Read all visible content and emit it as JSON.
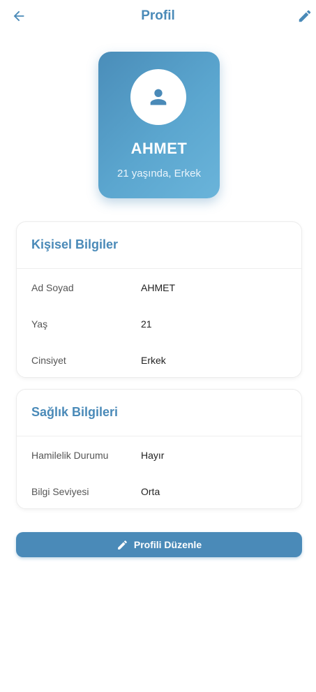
{
  "header": {
    "title": "Profil",
    "back_icon": "arrow-left-icon",
    "edit_icon": "pencil-icon"
  },
  "profile": {
    "avatar_icon": "person-icon",
    "name": "AHMET",
    "subtitle": "21 yaşında, Erkek"
  },
  "personal_info": {
    "title": "Kişisel Bilgiler",
    "rows": [
      {
        "label": "Ad Soyad",
        "value": "AHMET"
      },
      {
        "label": "Yaş",
        "value": "21"
      },
      {
        "label": "Cinsiyet",
        "value": "Erkek"
      }
    ]
  },
  "health_info": {
    "title": "Sağlık Bilgileri",
    "rows": [
      {
        "label": "Hamilelik Durumu",
        "value": "Hayır"
      },
      {
        "label": "Bilgi Seviyesi",
        "value": "Orta"
      }
    ]
  },
  "actions": {
    "edit_profile_label": "Profili Düzenle",
    "edit_profile_icon": "pencil-icon"
  },
  "colors": {
    "accent": "#4a8ab8",
    "card_gradient_start": "#4a8db9",
    "card_gradient_end": "#6ab4da",
    "background": "#ffffff"
  }
}
